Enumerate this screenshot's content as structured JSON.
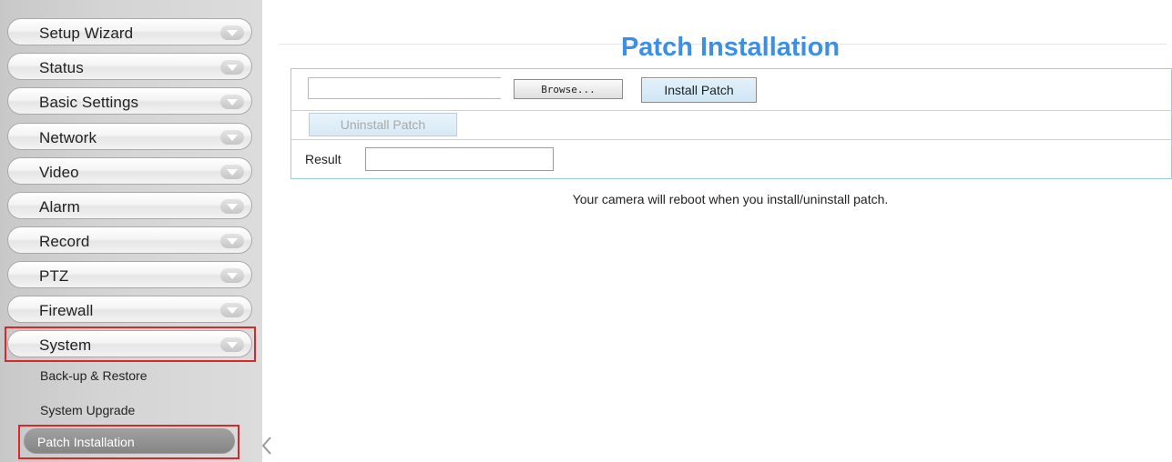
{
  "sidebar": {
    "menu": [
      {
        "label": "Setup Wizard"
      },
      {
        "label": "Status"
      },
      {
        "label": "Basic Settings"
      },
      {
        "label": "Network"
      },
      {
        "label": "Video"
      },
      {
        "label": "Alarm"
      },
      {
        "label": "Record"
      },
      {
        "label": "PTZ"
      },
      {
        "label": "Firewall"
      },
      {
        "label": "System"
      }
    ],
    "system_submenu": [
      {
        "label": "Back-up & Restore"
      },
      {
        "label": "System Upgrade"
      },
      {
        "label": "Patch Installation"
      }
    ],
    "highlight_color": "#d7282d"
  },
  "main": {
    "title": "Patch Installation",
    "browse_label": "Browse...",
    "install_label": "Install Patch",
    "uninstall_label": "Uninstall Patch",
    "result_label": "Result",
    "note": "Your camera will reboot when you install/uninstall patch.",
    "accent_color": "#3d8ee6"
  }
}
